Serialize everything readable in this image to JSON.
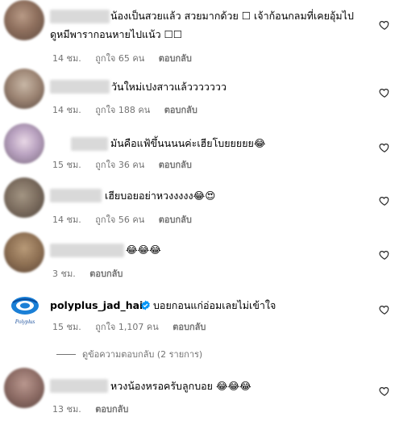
{
  "comments": [
    {
      "line1": "น้องเป็นสวยแล้ว สวยมากด้วย ☐ เจ้าก้อนกลมที่เคยอุ้มไป",
      "line2": "ดูหมีพารากอนหายไปแน้ว ☐☐",
      "time": "14 ชม.",
      "likes": "ถูกใจ 65 คน",
      "reply": "ตอบกลับ"
    },
    {
      "line1": "วันใหม่เปงสาวแล้ววววววว",
      "time": "14 ชม.",
      "likes": "ถูกใจ 188 คน",
      "reply": "ตอบกลับ"
    },
    {
      "line1": "มันคือแฟ้ขึ้นนนนค่ะเฮียโบยยยยย😂",
      "time": "15 ชม.",
      "likes": "ถูกใจ 36 คน",
      "reply": "ตอบกลับ"
    },
    {
      "line1": "เฮียบอยอย่าหวงงงงง😂😍",
      "time": "14 ชม.",
      "likes": "ถูกใจ 56 คน",
      "reply": "ตอบกลับ"
    },
    {
      "line1": "😂😂😂",
      "time": "3 ชม.",
      "reply": "ตอบกลับ"
    },
    {
      "username": "polyplus_jad_hai",
      "line1": "บอยกอนแก่อ่อมเลยไม่เข้าใจ",
      "time": "15 ชม.",
      "likes": "ถูกใจ 1,107 คน",
      "reply": "ตอบกลับ",
      "logo_text": "Polyplus",
      "view_replies": "ดูข้อความตอบกลับ (2 รายการ)"
    },
    {
      "line1": "หวงน้องหรอครับลูกบอย 😂😂😂",
      "time": "13 ชม.",
      "reply": "ตอบกลับ"
    }
  ],
  "colors": {
    "meta": "#737373",
    "verified": "#0095f6",
    "blur": "#d8d8d8"
  },
  "icons": {
    "like": "heart-outline-icon",
    "verified": "verified-badge-icon"
  }
}
